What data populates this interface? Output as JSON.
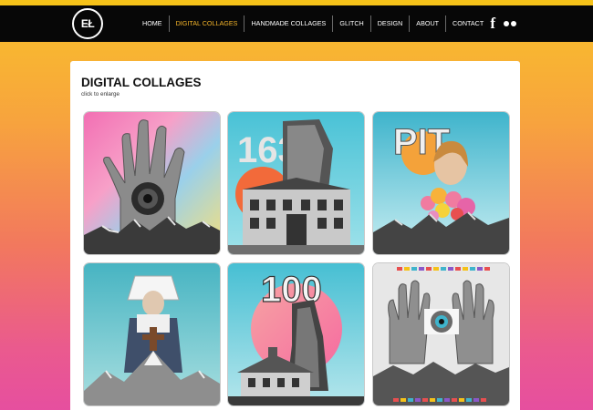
{
  "site": {
    "logo_text": "EŁ"
  },
  "nav": {
    "items": [
      {
        "label": "HOME",
        "active": false
      },
      {
        "label": "DIGITAL COLLAGES",
        "active": true
      },
      {
        "label": "HANDMADE COLLAGES",
        "active": false
      },
      {
        "label": "GLITCH",
        "active": false
      },
      {
        "label": "DESIGN",
        "active": false
      },
      {
        "label": "ABOUT",
        "active": false
      },
      {
        "label": "CONTACT",
        "active": false
      }
    ],
    "active_color": "#f5b52a"
  },
  "social": {
    "facebook_glyph": "f",
    "icons": [
      "facebook-icon",
      "flickr-icon"
    ]
  },
  "main": {
    "title": "DIGITAL COLLAGES",
    "subtitle": "click to enlarge"
  },
  "gallery": {
    "tiles": [
      {
        "name": "collage-hand-eye",
        "caption": ""
      },
      {
        "name": "collage-building-163",
        "caption": "163"
      },
      {
        "name": "collage-pit-woman",
        "caption": "PIT"
      },
      {
        "name": "collage-nun-mountain",
        "caption": ""
      },
      {
        "name": "collage-100-house",
        "caption": "100"
      },
      {
        "name": "collage-hands-eye",
        "caption": ""
      }
    ]
  },
  "colors": {
    "header_bg": "#070707",
    "accent": "#f5b52a",
    "gradient_top": "#f9c12a",
    "gradient_bottom": "#e64f9f"
  }
}
